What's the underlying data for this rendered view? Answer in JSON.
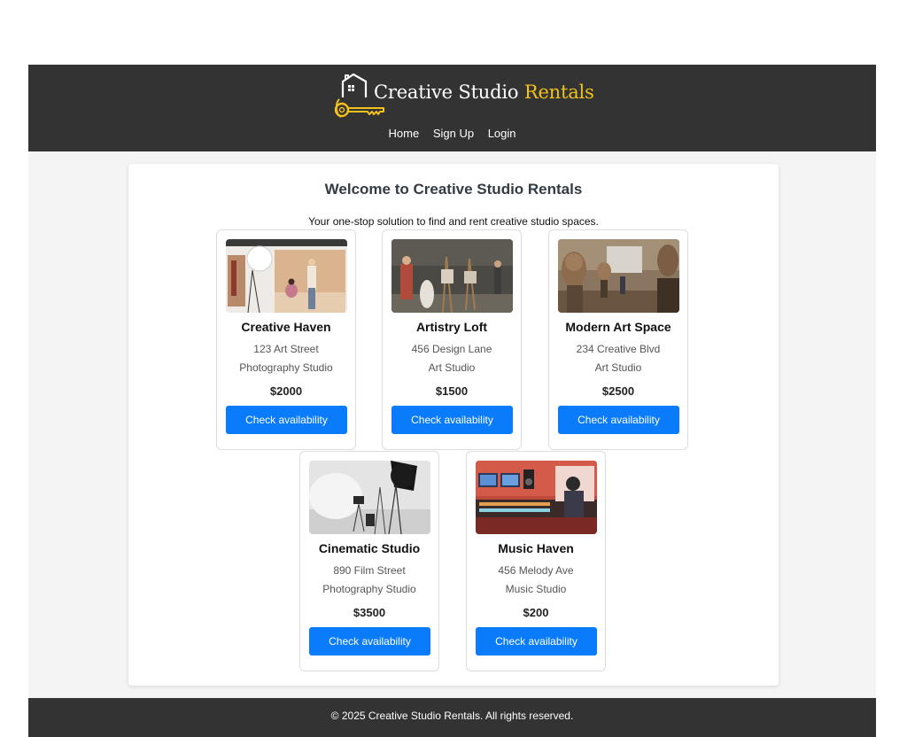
{
  "brand": {
    "name_part1": "Creative Studio",
    "name_part2": "Rentals",
    "accent_color": "#f2c21b",
    "logo_icon": "house-key-icon"
  },
  "nav": {
    "items": [
      "Home",
      "Sign Up",
      "Login"
    ]
  },
  "main": {
    "title": "Welcome to Creative Studio Rentals",
    "intro": "Your one-stop solution to find and rent creative studio spaces."
  },
  "studios": [
    {
      "name": "Creative Haven",
      "address": "123 Art Street",
      "type": "Photography Studio",
      "price": "$2000",
      "button_label": "Check availability"
    },
    {
      "name": "Artistry Loft",
      "address": "456 Design Lane",
      "type": "Art Studio",
      "price": "$1500",
      "button_label": "Check availability"
    },
    {
      "name": "Modern Art Space",
      "address": "234 Creative Blvd",
      "type": "Art Studio",
      "price": "$2500",
      "button_label": "Check availability"
    },
    {
      "name": "Cinematic Studio",
      "address": "890 Film Street",
      "type": "Photography Studio",
      "price": "$3500",
      "button_label": "Check availability"
    },
    {
      "name": "Music Haven",
      "address": "456 Melody Ave",
      "type": "Music Studio",
      "price": "$200",
      "button_label": "Check availability"
    }
  ],
  "footer": {
    "text": "© 2025 Creative Studio Rentals. All rights reserved."
  },
  "colors": {
    "header_bg": "#333333",
    "button_bg": "#0a7bfb",
    "page_bg": "#f4f4f4"
  }
}
